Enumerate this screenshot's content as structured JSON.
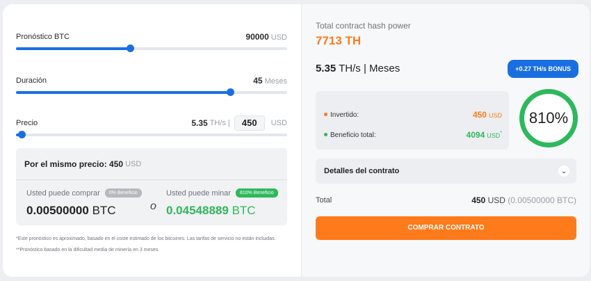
{
  "forecast": {
    "label": "Pronóstico BTC",
    "value": "90000",
    "unit": "USD",
    "slider_fraction": 0.42
  },
  "duration": {
    "label": "Duración",
    "value": "45",
    "unit": "Meses",
    "slider_fraction": 0.79
  },
  "price": {
    "label": "Precio",
    "rate": "5.35",
    "rate_unit": "TH/s",
    "separator": "|",
    "value": "450",
    "unit": "USD",
    "slider_fraction": 0.02
  },
  "same_price": {
    "heading": "Por el mismo precio: 450",
    "unit": "USD",
    "buy_label": "Usted puede comprar",
    "buy_badge": "0% Beneficio",
    "buy_value": "0.00500000",
    "buy_unit": "BTC",
    "or_text": "o",
    "mine_label": "Usted puede minar",
    "mine_badge": "810% Beneficio",
    "mine_value": "0.04548889",
    "mine_unit": "BTC"
  },
  "notes": {
    "note1": "*Este pronóstico es aproximado, basado en el coste estimado de los bitcoines. Las tarifas de servicio no están incluidas.",
    "note2": "**Pronóstico basado en la dificultad media de minería en 3 meses."
  },
  "contract": {
    "title": "Total contract hash power",
    "power": "7713 TH",
    "rate_value": "5.35",
    "rate_unit": "TH/s",
    "rate_sep": "|",
    "rate_period": "Meses",
    "bonus": "+0.27 TH/s BONUS",
    "invested_label": "Invertido:",
    "invested_value": "450",
    "invested_unit": "USD",
    "profit_label": "Beneficio total:",
    "profit_value": "4094",
    "profit_unit": "USD",
    "profit_mark": "*",
    "ring_percent": "810%",
    "details": "Detalles del contrato",
    "total_label": "Total",
    "total_value": "450",
    "total_unit": "USD",
    "total_btc": "(0.00500000 BTC)",
    "buy_button": "COMPRAR CONTRATO"
  },
  "colors": {
    "accent": "#1a6fe0",
    "orange": "#ff7a1a",
    "green": "#2eb85c",
    "badge_gray": "#b5b8bd"
  },
  "icons": {
    "chevron": "chevron-down-icon"
  }
}
